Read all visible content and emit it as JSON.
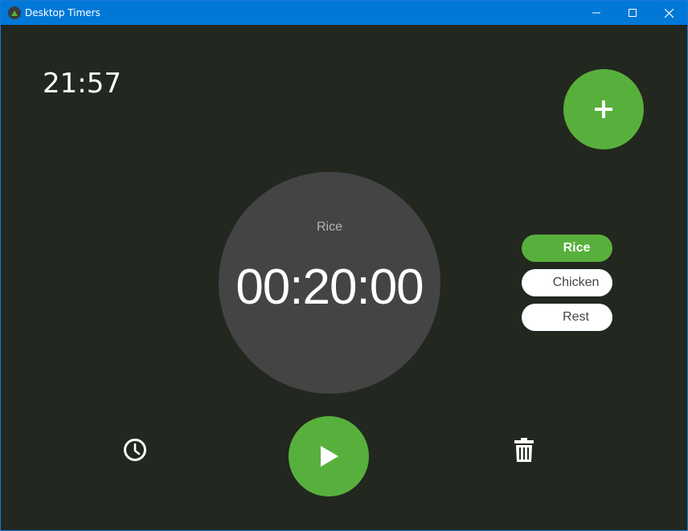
{
  "window": {
    "title": "Desktop Timers"
  },
  "clock": {
    "time": "21:57"
  },
  "active_timer": {
    "name": "Rice",
    "remaining": "00:20:00"
  },
  "timers": [
    {
      "label": "Rice",
      "active": true
    },
    {
      "label": "Chicken",
      "active": false
    },
    {
      "label": "Rest",
      "active": false
    }
  ],
  "icons": {
    "add": "plus-icon",
    "play": "play-icon",
    "history": "clock-icon",
    "delete": "trash-icon"
  },
  "colors": {
    "background": "#22271f",
    "accent": "#58b03c",
    "dial": "#444444",
    "titlebar": "#0078d7"
  }
}
